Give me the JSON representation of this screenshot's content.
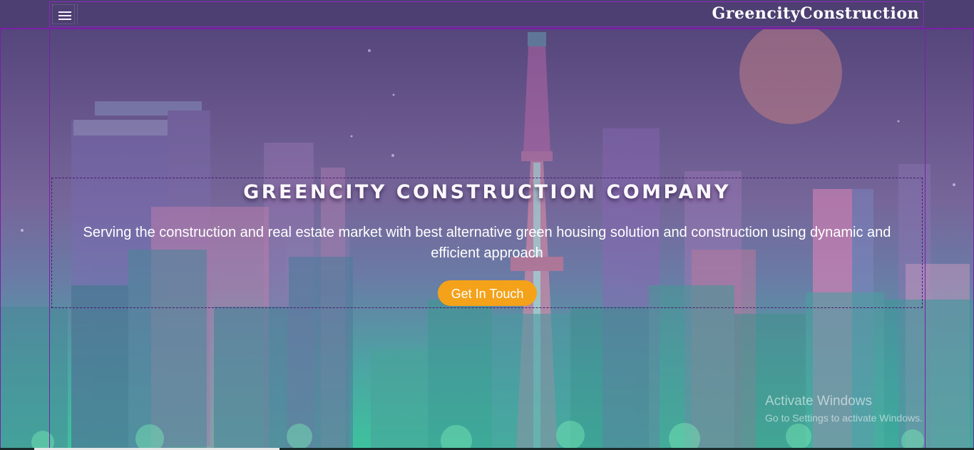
{
  "navbar": {
    "brand": "GreencityConstruction",
    "menu_icon": "hamburger-menu-icon"
  },
  "hero": {
    "title": "GREENCITY CONSTRUCTION COMPANY",
    "subtitle": "Serving the construction and real estate market with best alternative green housing solution and construction using dynamic and efficient approach",
    "cta_label": "Get In Touch",
    "cta_color": "#f4a21a"
  },
  "watermark": {
    "title": "Activate Windows",
    "subtitle": "Go to Settings to activate Windows."
  },
  "colors": {
    "navbar_bg": "#4d3f72",
    "guide_border": "#7a1fa6",
    "sky_top": "#4f4377",
    "sky_bottom": "#3fc49f"
  }
}
